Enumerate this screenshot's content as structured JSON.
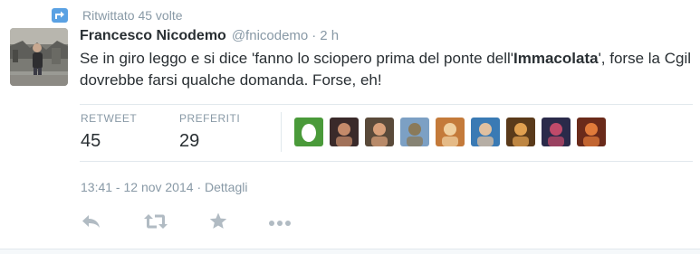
{
  "retweet_context": {
    "icon": "retweet-badge-icon",
    "text": "Ritwittato 45 volte"
  },
  "tweet": {
    "fullname": "Francesco Nicodemo",
    "username": "@fnicodemo",
    "separator": "·",
    "time": "2 h",
    "text_before": "Se in giro leggo e si dice 'fanno lo sciopero prima del ponte dell'",
    "text_bold": "Immacolata",
    "text_after": "', forse la Cgil dovrebbe farsi qualche domanda. Forse, eh!",
    "timestamp": "13:41 - 12 nov 2014",
    "details_sep": "·",
    "details_link": "Dettagli"
  },
  "stats": {
    "retweets": {
      "label": "RETWEET",
      "value": "45"
    },
    "favorites": {
      "label": "PREFERITI",
      "value": "29"
    }
  },
  "favoriters": [
    {
      "colors": [
        "#4a9a3a",
        "#ffffff"
      ]
    },
    {
      "colors": [
        "#3a2a2a",
        "#c48a6a"
      ]
    },
    {
      "colors": [
        "#5a4a3a",
        "#d8a07a"
      ]
    },
    {
      "colors": [
        "#7ca0c4",
        "#8a7a5a"
      ]
    },
    {
      "colors": [
        "#c47a3a",
        "#f0d0a0"
      ]
    },
    {
      "colors": [
        "#3a7ab4",
        "#e0c0a0"
      ]
    },
    {
      "colors": [
        "#5a3a1a",
        "#e0a050"
      ]
    },
    {
      "colors": [
        "#2a2a4a",
        "#c04a6a"
      ]
    },
    {
      "colors": [
        "#6a2a1a",
        "#e07a3a"
      ]
    }
  ],
  "actions": {
    "reply": "reply-icon",
    "retweet": "retweet-icon",
    "favorite": "star-icon",
    "more": "more-icon"
  },
  "colors": {
    "secondary_text": "#8899a6",
    "primary_text": "#292f33",
    "border": "#e1e8ed",
    "retweet_badge": "#5aa1e3",
    "action_icon": "#b1bbc3"
  }
}
